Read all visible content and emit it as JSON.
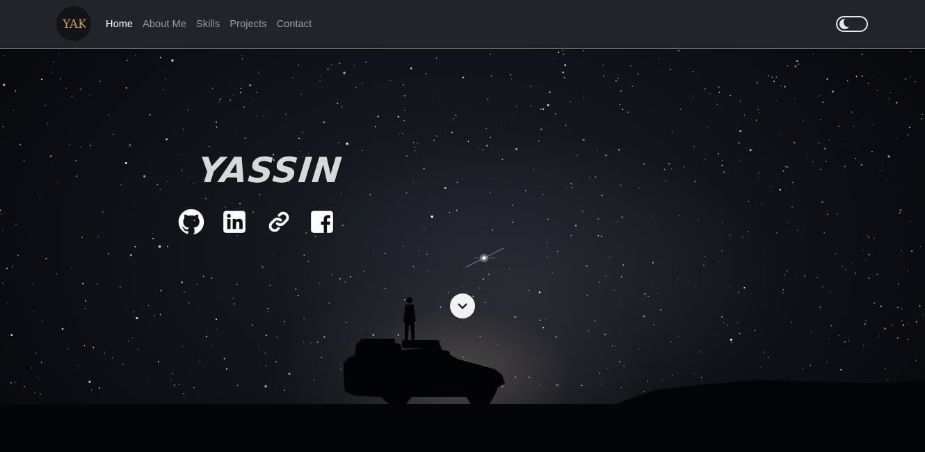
{
  "nav": {
    "logo_text": "YAK",
    "links": [
      {
        "label": "Home",
        "active": true
      },
      {
        "label": "About Me",
        "active": false
      },
      {
        "label": "Skills",
        "active": false
      },
      {
        "label": "Projects",
        "active": false
      },
      {
        "label": "Contact",
        "active": false
      }
    ],
    "theme_toggle_icon": "moon-icon"
  },
  "hero": {
    "title": "Yassin",
    "socials": [
      {
        "icon": "github-icon"
      },
      {
        "icon": "linkedin-icon"
      },
      {
        "icon": "link-icon"
      },
      {
        "icon": "facebook-icon"
      }
    ],
    "scroll_icon": "chevron-down-icon"
  },
  "colors": {
    "navbar_bg": "#212529",
    "nav_active": "#ffffff",
    "nav_inactive": "#9aa0a6",
    "accent_border": "#3aa0c0",
    "logo_gold": "#c9a24a"
  }
}
